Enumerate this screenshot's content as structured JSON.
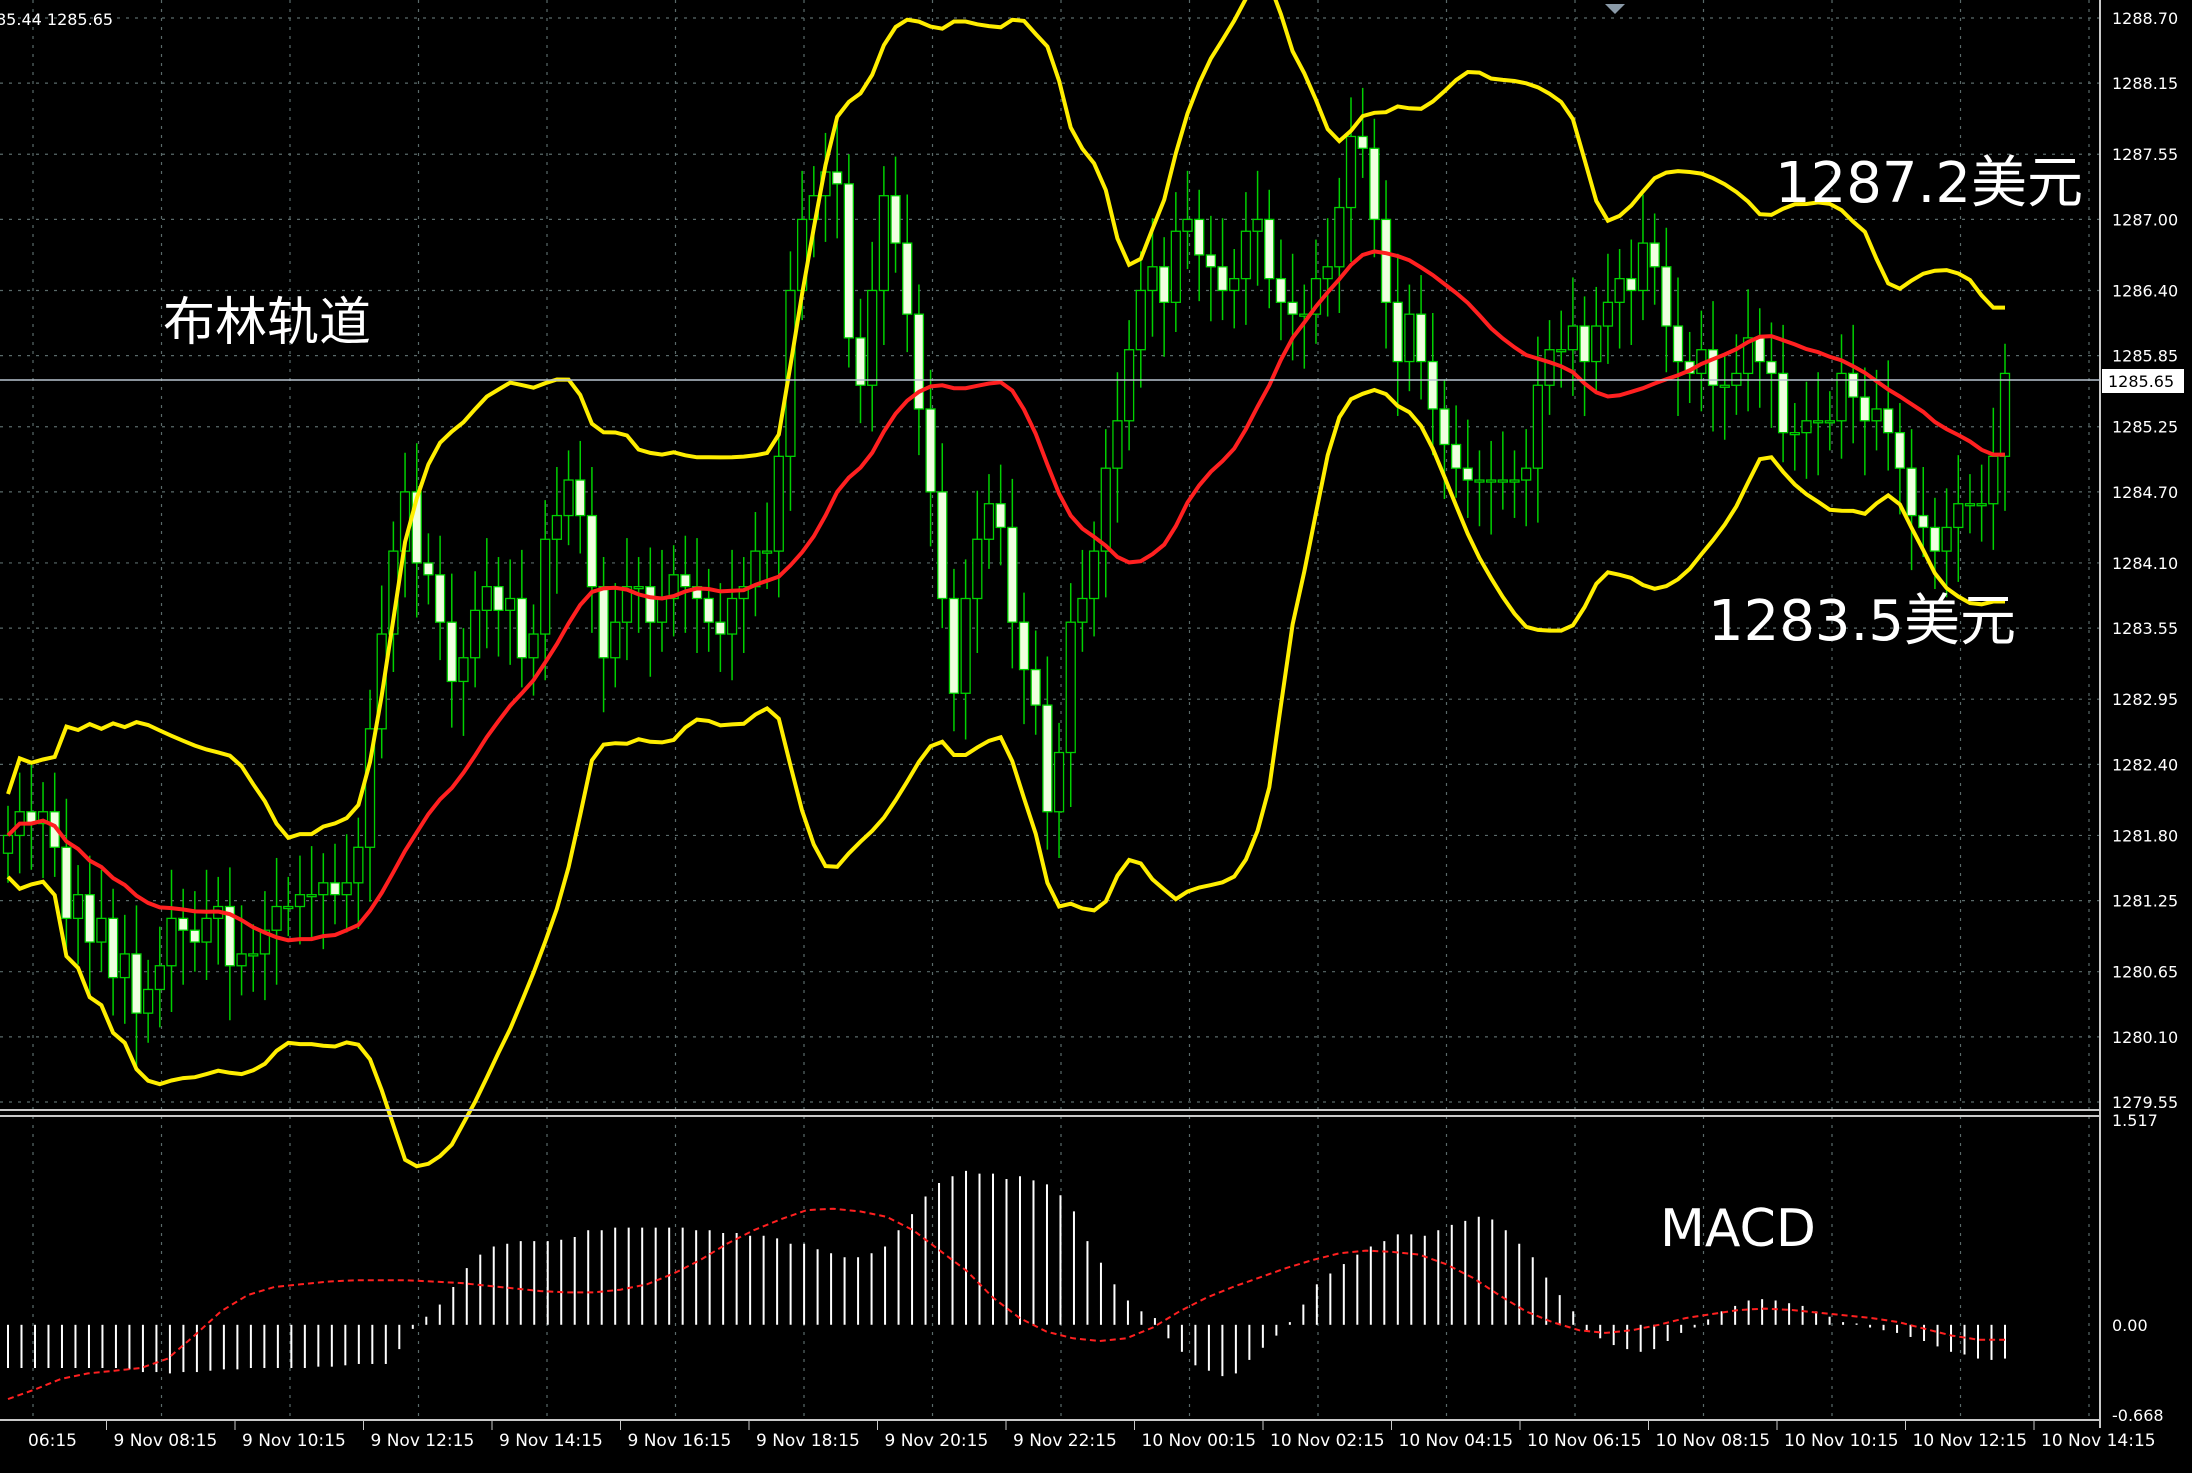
{
  "header": {
    "readout": "85.44 1285.65"
  },
  "annotations": {
    "bollinger_title": "布林轨道",
    "upper_price": "1287.2美元",
    "lower_price": "1283.5美元",
    "macd_title": "MACD"
  },
  "colors": {
    "background": "#000000",
    "grid": "#5a6a6a",
    "axis": "#c8c8c8",
    "bull_candle": "#00d000",
    "bear_candle": "#f0ffe0",
    "bollinger": "#ffee00",
    "ma_red": "#ff2020",
    "macd_hist": "#ffffff",
    "macd_signal": "#ff2020",
    "text": "#ffffff"
  },
  "chart_data": [
    {
      "type": "candlestick",
      "title": "",
      "ylim": [
        1279.55,
        1288.7
      ],
      "y_ticks": [
        "1288.70",
        "1288.15",
        "1287.55",
        "1287.00",
        "1286.40",
        "1285.85",
        "1285.25",
        "1284.70",
        "1284.10",
        "1283.55",
        "1282.95",
        "1282.40",
        "1281.80",
        "1281.25",
        "1280.65",
        "1280.10",
        "1279.55"
      ],
      "current_price": "1285.65",
      "x_ticks": [
        "06:15",
        "9 Nov 08:15",
        "9 Nov 10:15",
        "9 Nov 12:15",
        "9 Nov 14:15",
        "9 Nov 16:15",
        "9 Nov 18:15",
        "9 Nov 20:15",
        "9 Nov 22:15",
        "10 Nov 00:15",
        "10 Nov 02:15",
        "10 Nov 04:15",
        "10 Nov 06:15",
        "10 Nov 08:15",
        "10 Nov 10:15",
        "10 Nov 12:15",
        "10 Nov 14:15"
      ],
      "close": [
        1281.8,
        1282.0,
        1281.9,
        1282.0,
        1281.7,
        1281.1,
        1281.3,
        1280.9,
        1281.1,
        1280.6,
        1280.8,
        1280.3,
        1280.5,
        1280.7,
        1281.1,
        1281.0,
        1280.9,
        1281.1,
        1281.2,
        1280.7,
        1280.8,
        1280.8,
        1281.0,
        1281.2,
        1281.2,
        1281.3,
        1281.3,
        1281.4,
        1281.3,
        1281.4,
        1281.7,
        1282.7,
        1283.5,
        1284.2,
        1284.7,
        1284.1,
        1284.0,
        1283.6,
        1283.1,
        1283.3,
        1283.7,
        1283.9,
        1283.7,
        1283.8,
        1283.3,
        1283.5,
        1284.3,
        1284.5,
        1284.8,
        1284.5,
        1283.9,
        1283.3,
        1283.6,
        1283.9,
        1283.9,
        1283.6,
        1283.8,
        1284.0,
        1283.9,
        1283.8,
        1283.6,
        1283.5,
        1283.8,
        1283.9,
        1284.2,
        1284.2,
        1285.0,
        1286.4,
        1287.0,
        1287.2,
        1287.4,
        1287.3,
        1286.0,
        1285.6,
        1286.4,
        1287.2,
        1286.8,
        1286.2,
        1285.4,
        1284.7,
        1283.8,
        1283.0,
        1283.8,
        1284.3,
        1284.6,
        1284.4,
        1283.6,
        1283.2,
        1282.9,
        1282.0,
        1282.5,
        1283.6,
        1283.8,
        1284.2,
        1284.9,
        1285.3,
        1285.9,
        1286.4,
        1286.6,
        1286.3,
        1286.9,
        1287.0,
        1286.7,
        1286.6,
        1286.4,
        1286.5,
        1286.9,
        1287.0,
        1286.5,
        1286.3,
        1286.2,
        1286.2,
        1286.5,
        1286.6,
        1287.1,
        1287.7,
        1287.6,
        1287.0,
        1286.3,
        1285.8,
        1286.2,
        1285.8,
        1285.4,
        1285.1,
        1284.9,
        1284.8,
        1284.8,
        1284.8,
        1284.8,
        1284.8,
        1284.9,
        1285.6,
        1285.9,
        1285.9,
        1286.1,
        1285.8,
        1286.1,
        1286.3,
        1286.5,
        1286.4,
        1286.8,
        1286.6,
        1286.1,
        1285.8,
        1285.7,
        1285.9,
        1285.6,
        1285.6,
        1285.7,
        1286.0,
        1285.8,
        1285.7,
        1285.2,
        1285.2,
        1285.3,
        1285.3,
        1285.3,
        1285.7,
        1285.5,
        1285.3,
        1285.4,
        1285.2,
        1284.9,
        1284.5,
        1284.4,
        1284.2,
        1284.4,
        1284.6,
        1284.6,
        1284.6,
        1285.0,
        1285.7
      ],
      "series": [
        {
          "name": "",
          "role": "bollinger_upper",
          "values": [
            1283.1,
            1282.8,
            1282.6,
            1282.4,
            1282.2,
            1282.1,
            1282.0,
            1282.0,
            1282.0,
            1282.0,
            1282.0,
            1282.0,
            1282.0,
            1282.0,
            1282.0,
            1282.0,
            1282.0,
            1282.0,
            1282.0,
            1282.0,
            1282.0,
            1282.0,
            1282.0,
            1282.0,
            1282.0,
            1282.0,
            1282.0,
            1282.0,
            1282.0,
            1282.0,
            1281.8,
            1281.9,
            1282.3,
            1282.9,
            1283.5,
            1283.9,
            1284.1,
            1284.3,
            1284.4,
            1284.6,
            1284.7,
            1284.9,
            1285.1,
            1285.2,
            1285.3,
            1285.3,
            1285.2,
            1285.1,
            1285.0,
            1284.9,
            1284.8,
            1284.6,
            1284.4,
            1284.2,
            1284.1,
            1284.1,
            1284.0,
            1284.0,
            1284.0,
            1284.0,
            1283.9,
            1283.9,
            1283.9,
            1284.0,
            1284.2,
            1284.6,
            1285.4,
            1286.5,
            1287.2,
            1287.7,
            1288.1,
            1288.3,
            1288.3,
            1288.3,
            1288.3,
            1288.4,
            1288.4,
            1288.4,
            1288.4,
            1288.3,
            1288.3,
            1288.3,
            1288.3,
            1288.3,
            1288.3,
            1288.4,
            1288.5,
            1288.5,
            1288.5,
            1288.4,
            1288.3,
            1288.1,
            1287.9,
            1287.8,
            1287.7,
            1287.7,
            1287.7,
            1287.8,
            1287.8,
            1287.7,
            1287.7,
            1287.7,
            1287.9,
            1288.1,
            1288.4,
            1288.7,
            1288.8,
            1288.7,
            1288.5,
            1288.3,
            1288.1,
            1288.0,
            1287.9,
            1287.9,
            1287.9,
            1287.9,
            1287.8,
            1287.8,
            1287.8,
            1287.8,
            1287.7,
            1287.7,
            1287.6,
            1287.6,
            1287.6,
            1287.6,
            1287.6,
            1287.5,
            1287.5,
            1287.2,
            1287.0,
            1286.9,
            1286.9,
            1286.8,
            1286.8,
            1286.7,
            1286.6,
            1286.6,
            1286.6,
            1286.7,
            1286.7,
            1286.7,
            1286.7,
            1286.6,
            1286.5,
            1286.5,
            1286.4
          ],
          "note_unused": "placeholder"
        }
      ]
    },
    {
      "type": "bar",
      "title": "MACD",
      "ylim": [
        -0.668,
        1.517
      ],
      "y_ticks": [
        "1.517",
        "0.00",
        "-0.668"
      ],
      "series": [
        {
          "name": "",
          "role": "histogram",
          "values": [
            -0.32,
            -0.32,
            -0.32,
            -0.32,
            -0.32,
            -0.32,
            -0.32,
            -0.32,
            -0.32,
            -0.33,
            -0.35,
            -0.35,
            -0.36,
            -0.35,
            -0.35,
            -0.34,
            -0.33,
            -0.33,
            -0.32,
            -0.32,
            -0.32,
            -0.32,
            -0.32,
            -0.31,
            -0.31,
            -0.3,
            -0.29,
            -0.29,
            -0.29,
            -0.18,
            -0.03,
            0.06,
            0.15,
            0.28,
            0.42,
            0.52,
            0.58,
            0.6,
            0.62,
            0.62,
            0.62,
            0.63,
            0.65,
            0.7,
            0.7,
            0.72,
            0.72,
            0.72,
            0.72,
            0.72,
            0.72,
            0.7,
            0.7,
            0.68,
            0.68,
            0.66,
            0.66,
            0.64,
            0.6,
            0.6,
            0.56,
            0.53,
            0.5,
            0.5,
            0.53,
            0.58,
            0.7,
            0.82,
            0.95,
            1.05,
            1.1,
            1.14,
            1.12,
            1.12,
            1.08,
            1.1,
            1.07,
            1.04,
            0.96,
            0.84,
            0.62,
            0.46,
            0.3,
            0.18,
            0.1,
            0.05,
            -0.1,
            -0.2,
            -0.3,
            -0.34,
            -0.38,
            -0.36,
            -0.26,
            -0.17,
            -0.08,
            0.02,
            0.15,
            0.3,
            0.38,
            0.45,
            0.52,
            0.58,
            0.62,
            0.67,
            0.67,
            0.66,
            0.7,
            0.74,
            0.77,
            0.8,
            0.78,
            0.7,
            0.6,
            0.5,
            0.35,
            0.22,
            0.1,
            -0.05,
            -0.1,
            -0.15,
            -0.18,
            -0.2,
            -0.18,
            -0.12,
            -0.06,
            -0.02,
            0.04,
            0.1,
            0.14,
            0.18,
            0.19,
            0.18,
            0.16,
            0.14,
            0.1,
            0.06,
            0.02,
            0.01,
            -0.02,
            -0.04,
            -0.06,
            -0.09,
            -0.12,
            -0.16,
            -0.2,
            -0.22,
            -0.25,
            -0.26,
            -0.25
          ]
        },
        {
          "name": "",
          "role": "signal",
          "values": [
            -0.55,
            -0.48,
            -0.4,
            -0.36,
            -0.34,
            -0.32,
            -0.25,
            -0.08,
            0.1,
            0.22,
            0.28,
            0.3,
            0.32,
            0.33,
            0.33,
            0.33,
            0.32,
            0.31,
            0.29,
            0.27,
            0.25,
            0.24,
            0.24,
            0.26,
            0.3,
            0.38,
            0.48,
            0.6,
            0.7,
            0.78,
            0.85,
            0.86,
            0.84,
            0.8,
            0.7,
            0.55,
            0.4,
            0.2,
            0.05,
            -0.05,
            -0.1,
            -0.12,
            -0.1,
            -0.02,
            0.1,
            0.2,
            0.28,
            0.35,
            0.42,
            0.48,
            0.53,
            0.55,
            0.54,
            0.52,
            0.45,
            0.35,
            0.22,
            0.1,
            0.02,
            -0.04,
            -0.06,
            -0.04,
            0.0,
            0.05,
            0.08,
            0.11,
            0.12,
            0.11,
            0.09,
            0.07,
            0.05,
            0.02,
            -0.03,
            -0.08,
            -0.11,
            -0.11
          ]
        }
      ]
    }
  ]
}
